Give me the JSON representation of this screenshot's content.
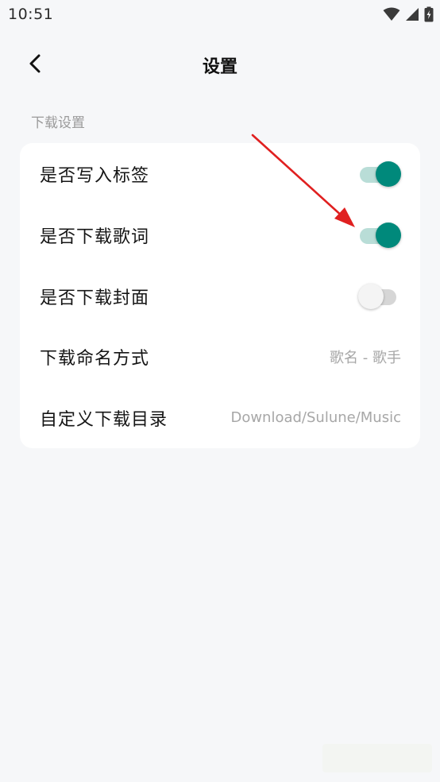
{
  "status_bar": {
    "time": "10:51",
    "icons": [
      "wifi-icon",
      "cellular-signal-icon",
      "battery-charging-icon"
    ]
  },
  "header": {
    "title": "设置",
    "back_icon": "chevron-left-icon"
  },
  "section": {
    "label": "下载设置"
  },
  "settings": {
    "items": [
      {
        "label": "是否写入标签",
        "type": "switch",
        "checked": true
      },
      {
        "label": "是否下载歌词",
        "type": "switch",
        "checked": true
      },
      {
        "label": "是否下载封面",
        "type": "switch",
        "checked": false
      },
      {
        "label": "下载命名方式",
        "type": "value",
        "value": "歌名 - 歌手"
      },
      {
        "label": "自定义下载目录",
        "type": "value",
        "value": "Download/Sulune/Music"
      }
    ]
  },
  "colors": {
    "accent": "#00897b",
    "accent_track": "#b9ddd7",
    "annotation": "#e02020",
    "background": "#f6f7f9"
  }
}
